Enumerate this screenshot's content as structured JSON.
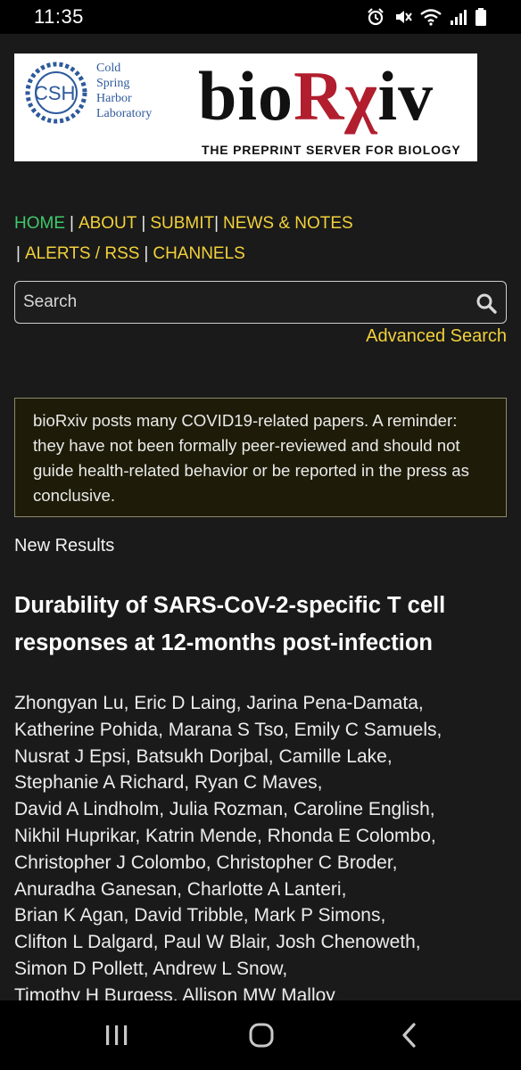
{
  "status_bar": {
    "time": "11:35"
  },
  "banner": {
    "csh_logo_text": "CSH",
    "csh_lines": [
      "Cold",
      "Spring",
      "Harbor",
      "Laboratory"
    ],
    "brand_pre": "bio",
    "brand_r": "R",
    "brand_x": "χ",
    "brand_post": "iv",
    "tagline": "THE PREPRINT SERVER FOR BIOLOGY"
  },
  "nav": {
    "home": "HOME",
    "about": "ABOUT",
    "submit": "SUBMIT",
    "news": "NEWS & NOTES",
    "alerts": "ALERTS / RSS",
    "channels": "CHANNELS",
    "separator": "|"
  },
  "search": {
    "placeholder": "Search",
    "advanced": "Advanced Search"
  },
  "notice": "bioRxiv posts many COVID19-related papers. A reminder: they have not been formally peer-reviewed and should not guide health-related behavior or be reported in the press as conclusive.",
  "article": {
    "type": "New Results",
    "title": "Durability of SARS-CoV-2-specific T cell responses at 12-months post-infection",
    "author_lines": [
      "Zhongyan Lu, Eric D Laing, Jarina Pena-Damata,",
      "Katherine Pohida, Marana S Tso, Emily C Samuels,",
      "Nusrat J Epsi, Batsukh Dorjbal, Camille Lake,",
      "Stephanie A Richard, Ryan C Maves,",
      "David A Lindholm, Julia Rozman, Caroline English,",
      "Nikhil Huprikar, Katrin Mende, Rhonda E Colombo,",
      "Christopher J Colombo, Christopher C Broder,",
      "Anuradha Ganesan, Charlotte A Lanteri,",
      "Brian K Agan, David Tribble, Mark P Simons,",
      "Clifton L Dalgard, Paul W Blair, Josh Chenoweth,",
      "Simon D Pollett, Andrew L Snow,",
      "Timothy H Burgess, Allison MW Malloy"
    ]
  },
  "colors": {
    "link": "#f2d13b",
    "active": "#3fc96a",
    "brand_red": "#b11e2e",
    "background": "#1a1a1a"
  },
  "icons": [
    "alarm-icon",
    "mute-icon",
    "wifi-icon",
    "signal-icon",
    "battery-icon",
    "search-icon",
    "recents-icon",
    "home-icon",
    "back-icon"
  ]
}
